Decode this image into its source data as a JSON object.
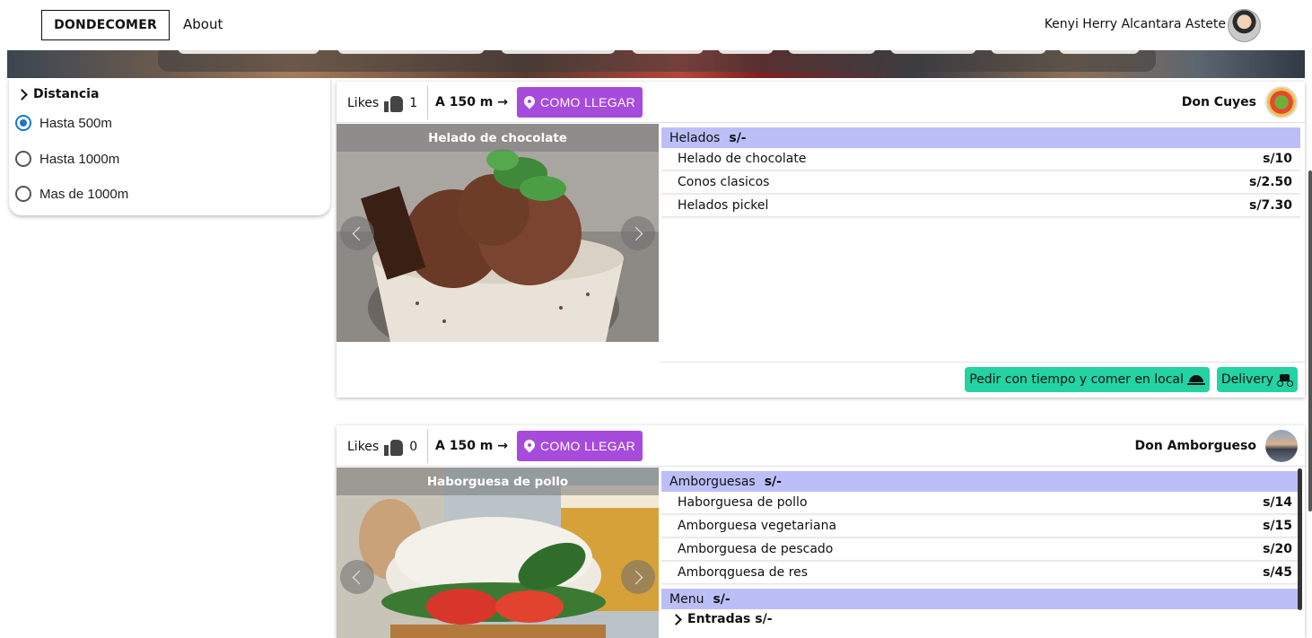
{
  "nav": {
    "brand": "DONDECOMER",
    "about": "About",
    "user_name": "Kenyi Herry Alcantara Astete"
  },
  "filter": {
    "title": "Distancia",
    "options": [
      {
        "label": "Hasta 500m",
        "selected": true
      },
      {
        "label": "Hasta 1000m",
        "selected": false
      },
      {
        "label": "Mas de 1000m",
        "selected": false
      }
    ]
  },
  "restaurants": [
    {
      "likes_label": "Likes",
      "likes": "1",
      "distance": "A 150 m →",
      "directions_label": "COMO LLEGAR",
      "name": "Don Cuyes",
      "photo_caption": "Helado de chocolate",
      "categories": [
        {
          "name": "Helados",
          "price_label": "s/-",
          "items": [
            {
              "name": "Helado de chocolate",
              "price": "s/10"
            },
            {
              "name": "Conos clasicos",
              "price": "s/2.50"
            },
            {
              "name": "Helados pickel",
              "price": "s/7.30"
            }
          ]
        }
      ],
      "actions": {
        "order_local": "Pedir con tiempo y comer en local",
        "delivery": "Delivery"
      }
    },
    {
      "likes_label": "Likes",
      "likes": "0",
      "distance": "A 150 m →",
      "directions_label": "COMO LLEGAR",
      "name": "Don Amborgueso",
      "photo_caption": "Haborguesa de pollo",
      "categories": [
        {
          "name": "Amborguesas",
          "price_label": "s/-",
          "items": [
            {
              "name": "Haborguesa de pollo",
              "price": "s/14"
            },
            {
              "name": "Amborguesa vegetariana",
              "price": "s/15"
            },
            {
              "name": "Amborguesa de pescado",
              "price": "s/20"
            },
            {
              "name": "Amborqguesa de res",
              "price": "s/45"
            }
          ]
        },
        {
          "name": "Menu",
          "price_label": "s/-",
          "items": []
        }
      ],
      "subcategory": "Entradas s/-"
    }
  ],
  "colors": {
    "accent_purple": "#a64bdb",
    "category_bg": "#bcbff7",
    "action_green": "#23d3a3",
    "radio_blue": "#1976d2"
  }
}
